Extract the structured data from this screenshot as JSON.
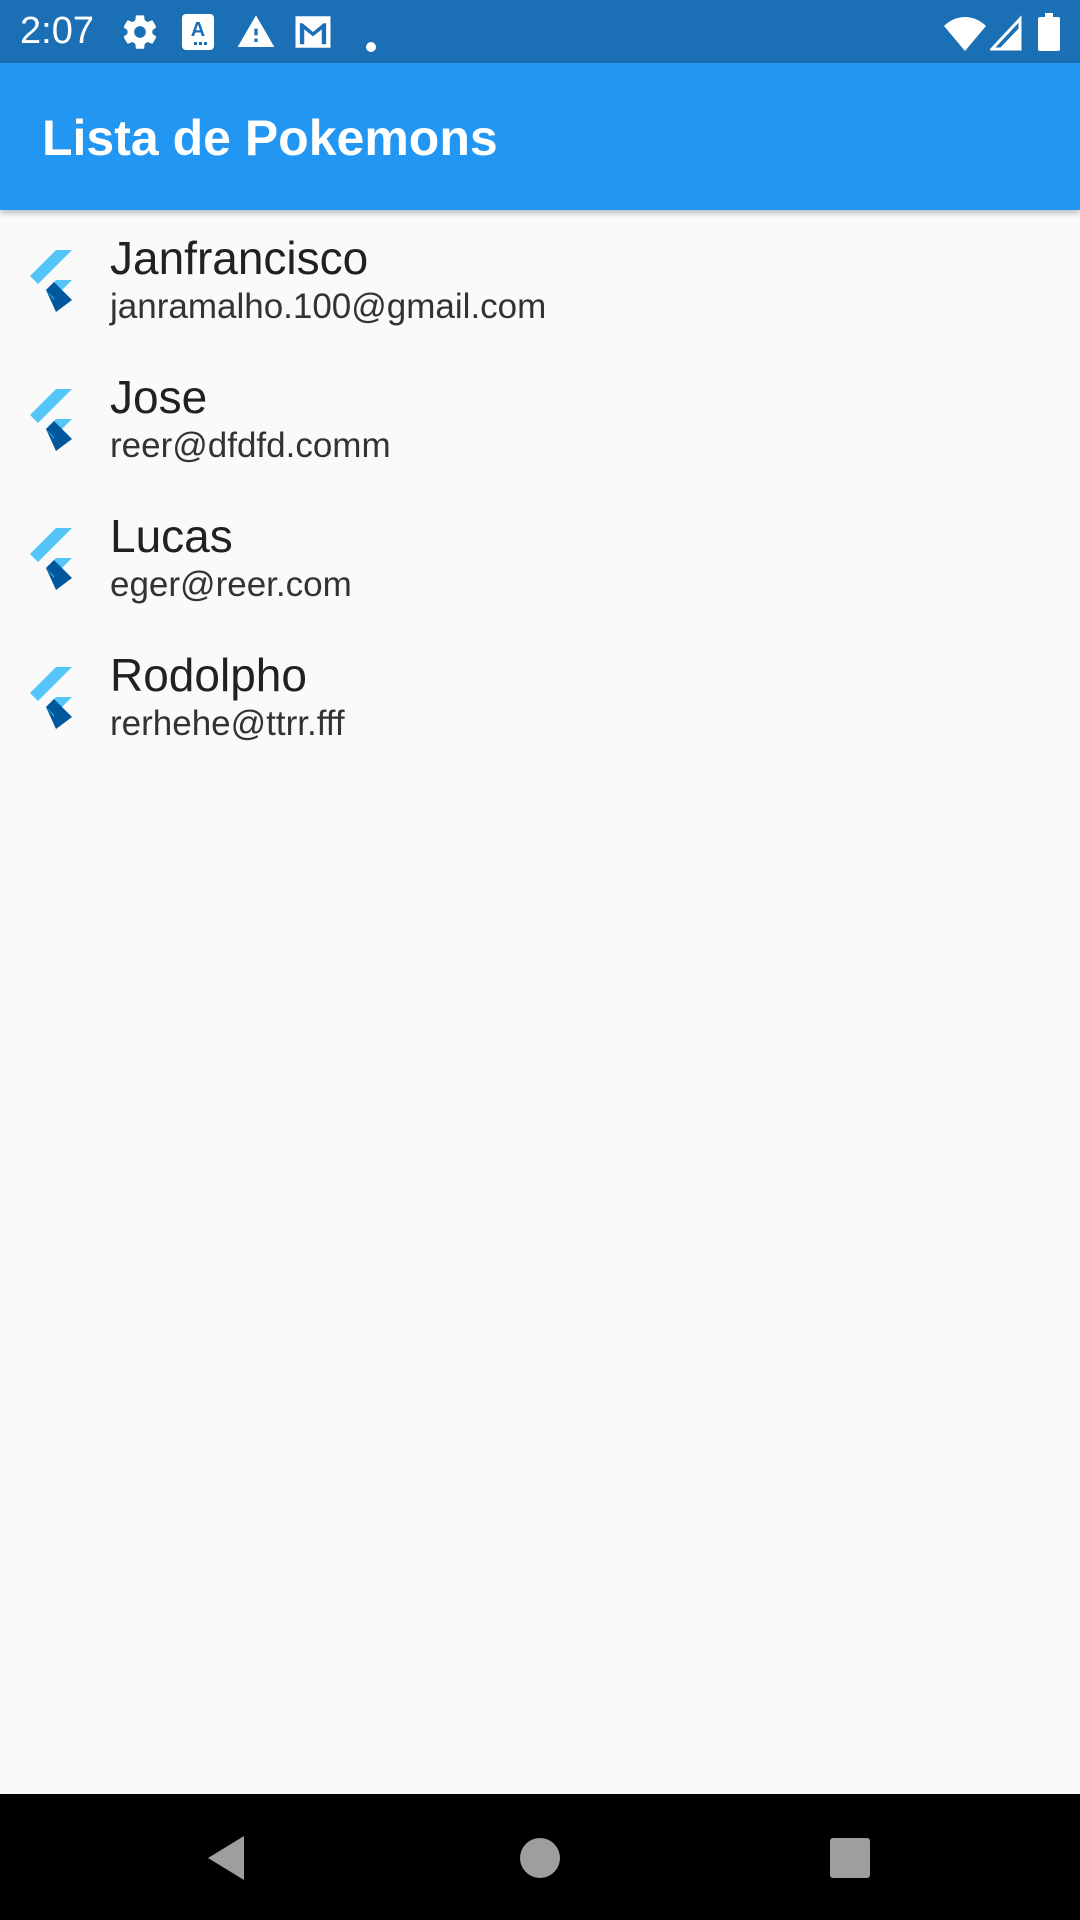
{
  "status_bar": {
    "time": "2:07",
    "icons": [
      "settings-icon",
      "translate-icon",
      "warning-icon",
      "gmail-icon",
      "dot-icon",
      "wifi-icon",
      "signal-icon",
      "battery-icon"
    ],
    "background": "#1a6fb5"
  },
  "app_bar": {
    "title": "Lista de Pokemons",
    "background": "#2196f3"
  },
  "list": {
    "items": [
      {
        "title": "Janfrancisco",
        "subtitle": "janramalho.100@gmail.com",
        "icon": "flutter-logo-icon"
      },
      {
        "title": "Jose",
        "subtitle": "reer@dfdfd.comm",
        "icon": "flutter-logo-icon"
      },
      {
        "title": "Lucas",
        "subtitle": "eger@reer.com",
        "icon": "flutter-logo-icon"
      },
      {
        "title": "Rodolpho",
        "subtitle": "rerhehe@ttrr.fff",
        "icon": "flutter-logo-icon"
      }
    ]
  },
  "nav_bar": {
    "buttons": [
      "back-icon",
      "home-icon",
      "recents-icon"
    ]
  }
}
